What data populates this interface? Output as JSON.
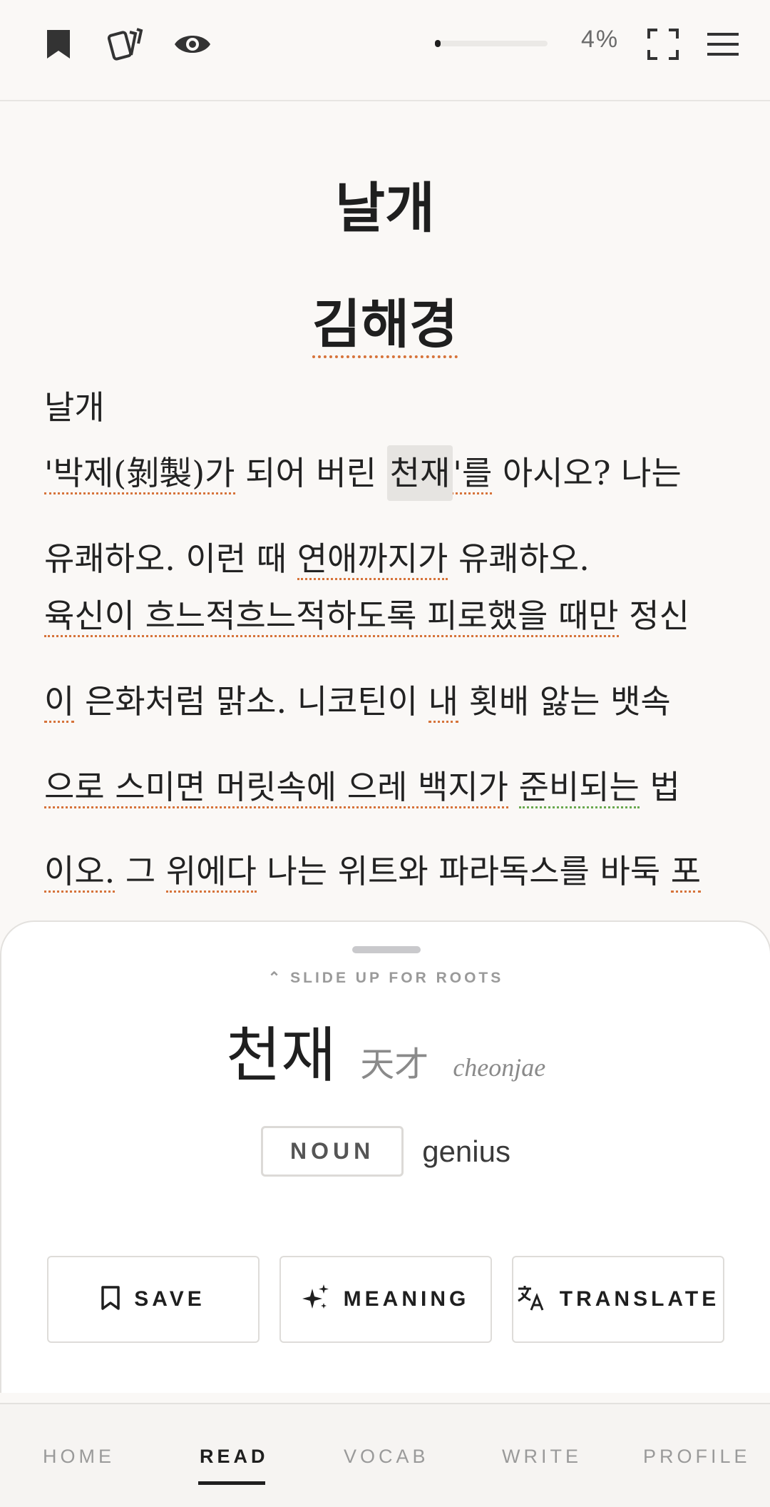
{
  "topbar": {
    "icons": [
      "bookmark-icon",
      "cards-icon",
      "eye-icon",
      "fullscreen-icon",
      "menu-icon"
    ],
    "progress_percent": 4,
    "progress_label": "4%"
  },
  "reader": {
    "title": "날개",
    "author": "김해경",
    "lines": [
      "날개",
      "'박제(剝製)가 되어 버린 천재'를 아시오? 나는",
      "유쾌하오. 이런 때 연애까지가 유쾌하오.",
      "육신이 흐느적흐느적하도록 피로했을 때만 정신",
      "이 은화처럼 맑소. 니코틴이 내 횟배 앓는 뱃속",
      "으로 스미면 머릿속에 으레 백지가 준비되는 법",
      "이오. 그 위에다 나는 위트와 파라독스를 바둑 포"
    ],
    "highlighted_word": "천재"
  },
  "sheet": {
    "hint": "⌃ SLIDE UP FOR ROOTS",
    "word": "천재",
    "hanja": "天才",
    "romanization": "cheonjae",
    "part_of_speech": "NOUN",
    "gloss": "genius",
    "actions": {
      "save": "SAVE",
      "meaning": "MEANING",
      "translate": "TRANSLATE"
    }
  },
  "nav": {
    "items": [
      "HOME",
      "READ",
      "VOCAB",
      "WRITE",
      "PROFILE"
    ],
    "active": "READ"
  },
  "colors": {
    "background": "#faf8f6",
    "underline": "#d6733a",
    "highlight": "#e6e4e1",
    "text": "#1f1f1f"
  }
}
